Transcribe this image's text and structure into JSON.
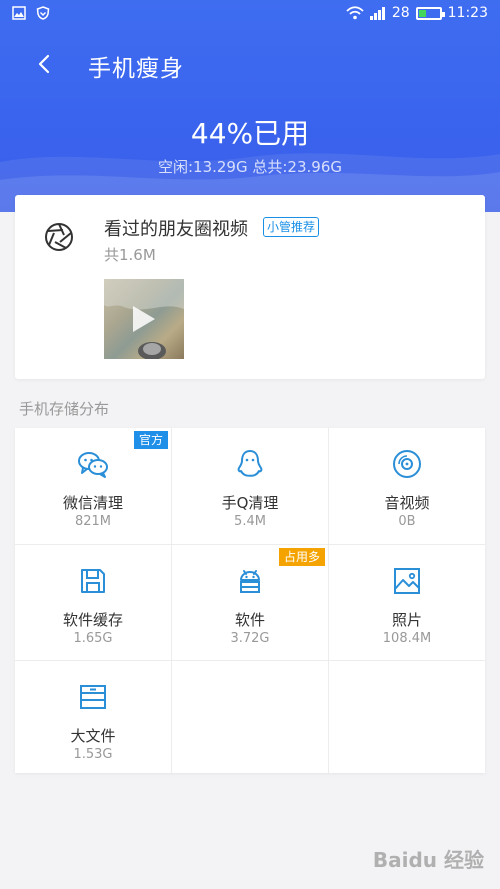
{
  "status": {
    "signal_strength": "28",
    "time": "11:23",
    "battery_fill": 0.35,
    "battery_color": "#44d65a"
  },
  "header": {
    "title": "手机瘦身",
    "usage": "44%已用",
    "usage_sub": "空闲:13.29G 总共:23.96G"
  },
  "recommendation": {
    "icon": "shutter-icon",
    "title": "看过的朋友圈视频",
    "tag": "小管推荐",
    "size": "共1.6M"
  },
  "section_label": "手机存储分布",
  "storage": [
    {
      "icon": "wechat-icon",
      "name": "微信清理",
      "size": "821M",
      "badge": "官方",
      "badge_color": "#1f8fe8"
    },
    {
      "icon": "qq-icon",
      "name": "手Q清理",
      "size": "5.4M",
      "badge": "",
      "badge_color": ""
    },
    {
      "icon": "disc-icon",
      "name": "音视频",
      "size": "0B",
      "badge": "",
      "badge_color": ""
    },
    {
      "icon": "save-icon",
      "name": "软件缓存",
      "size": "1.65G",
      "badge": "",
      "badge_color": ""
    },
    {
      "icon": "android-icon",
      "name": "软件",
      "size": "3.72G",
      "badge": "占用多",
      "badge_color": "#f5a300"
    },
    {
      "icon": "image-icon",
      "name": "照片",
      "size": "108.4M",
      "badge": "",
      "badge_color": ""
    },
    {
      "icon": "archive-icon",
      "name": "大文件",
      "size": "1.53G",
      "badge": "",
      "badge_color": ""
    }
  ],
  "watermark": "Baidu 经验",
  "colors": {
    "header_blue": "#3f6df0",
    "accent_blue": "#1a8fe6",
    "icon_blue": "#2b8fd8",
    "badge_orange": "#f5a300"
  }
}
